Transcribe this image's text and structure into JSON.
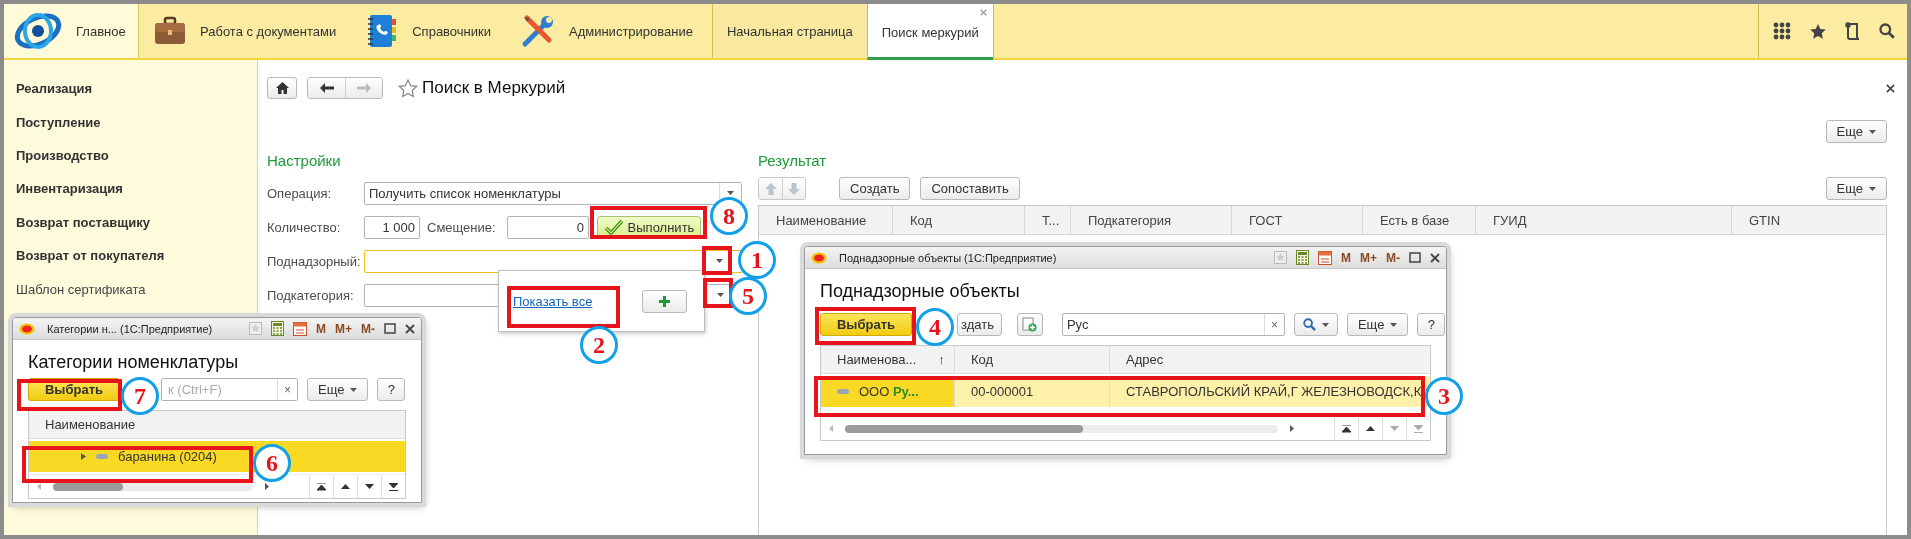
{
  "top_sections": [
    {
      "label": "Главное",
      "selected": true
    },
    {
      "label": "Работа с документами",
      "selected": false
    },
    {
      "label": "Справочники",
      "selected": false
    },
    {
      "label": "Администрирование",
      "selected": false
    }
  ],
  "open_tabs": [
    {
      "label": "Начальная страница",
      "selected": false
    },
    {
      "label": "Поиск меркурий",
      "selected": true
    }
  ],
  "sidebar": {
    "items": [
      {
        "label": "Реализация",
        "kind": "section"
      },
      {
        "label": "Поступление",
        "kind": "section"
      },
      {
        "label": "Производство",
        "kind": "section"
      },
      {
        "label": "Инвентаризация",
        "kind": "section"
      },
      {
        "label": "Возврат поставщику",
        "kind": "section"
      },
      {
        "label": "Возврат от покупателя",
        "kind": "section"
      },
      {
        "label": "Шаблон сертификата",
        "kind": "command"
      }
    ]
  },
  "form": {
    "title": "Поиск в Меркурий",
    "more_button": "Еще",
    "settings": {
      "heading": "Настройки",
      "operation": {
        "label": "Операция:",
        "value": "Получить список номенклатуры"
      },
      "quantity": {
        "label": "Количество:",
        "value": "1 000"
      },
      "offset": {
        "label": "Смещение:",
        "value": "0"
      },
      "run_button": "Выполнить",
      "supervised": {
        "label": "Поднадзорный:",
        "focused": true
      },
      "subcategory": {
        "label": "Подкатегория:",
        "focused": false
      },
      "dropdown": {
        "link": "Показать все"
      }
    },
    "result": {
      "heading": "Результат",
      "buttons": [
        "Создать",
        "Сопоставить"
      ],
      "more_button": "Еще",
      "columns": [
        "Наименование",
        "Код",
        "Т...",
        "Подкатегория",
        "ГОСТ",
        "Есть в базе",
        "ГУИД",
        "GTIN"
      ]
    }
  },
  "windows": [
    {
      "title": "Поднадзорные объекты (1С:Предприятие)",
      "memory_buttons": [
        "M",
        "M+",
        "M-"
      ],
      "heading": "Поднадзорные объекты",
      "toolbar": [
        {
          "kind": "default_button",
          "label": "Выбрать"
        },
        {
          "kind": "partial_button",
          "label": "здать"
        },
        {
          "kind": "add_button"
        },
        {
          "kind": "search",
          "value": "Рус",
          "clear": "×"
        },
        {
          "kind": "search_menu"
        },
        {
          "kind": "menu_button",
          "label": "Еще"
        },
        {
          "kind": "button",
          "label": "?"
        }
      ],
      "columns": [
        {
          "label": "Наименова...",
          "sort": "↑"
        },
        {
          "label": "Код"
        },
        {
          "label": "Адрес"
        }
      ],
      "rows": [
        {
          "selected": true,
          "expandable": false,
          "cells": [
            "ООО **Ру...**",
            "00-000001",
            "СТАВРОПОЛЬСКИЙ КРАЙ,Г ЖЕЛЕЗНОВОДСК,К"
          ]
        }
      ]
    },
    {
      "title": "Категории н... (1С:Предприятие)",
      "memory_buttons": [
        "M",
        "M+",
        "M-"
      ],
      "heading": "Категории номенклатуры",
      "toolbar": [
        {
          "kind": "default_button",
          "label": "Выбрать"
        },
        {
          "kind": "search",
          "placeholder": "к (Ctrl+F)",
          "clear": "×"
        },
        {
          "kind": "menu_button",
          "label": "Еще"
        },
        {
          "kind": "button",
          "label": "?"
        }
      ],
      "columns": [
        {
          "label": "Наименование"
        }
      ],
      "rows": [
        {
          "selected": true,
          "expandable": true,
          "cells": [
            "баранина (0204)"
          ]
        }
      ]
    }
  ],
  "annotations": [
    {
      "number": "1"
    },
    {
      "number": "2"
    },
    {
      "number": "3"
    },
    {
      "number": "4"
    },
    {
      "number": "5"
    },
    {
      "number": "6"
    },
    {
      "number": "7"
    },
    {
      "number": "8"
    }
  ]
}
